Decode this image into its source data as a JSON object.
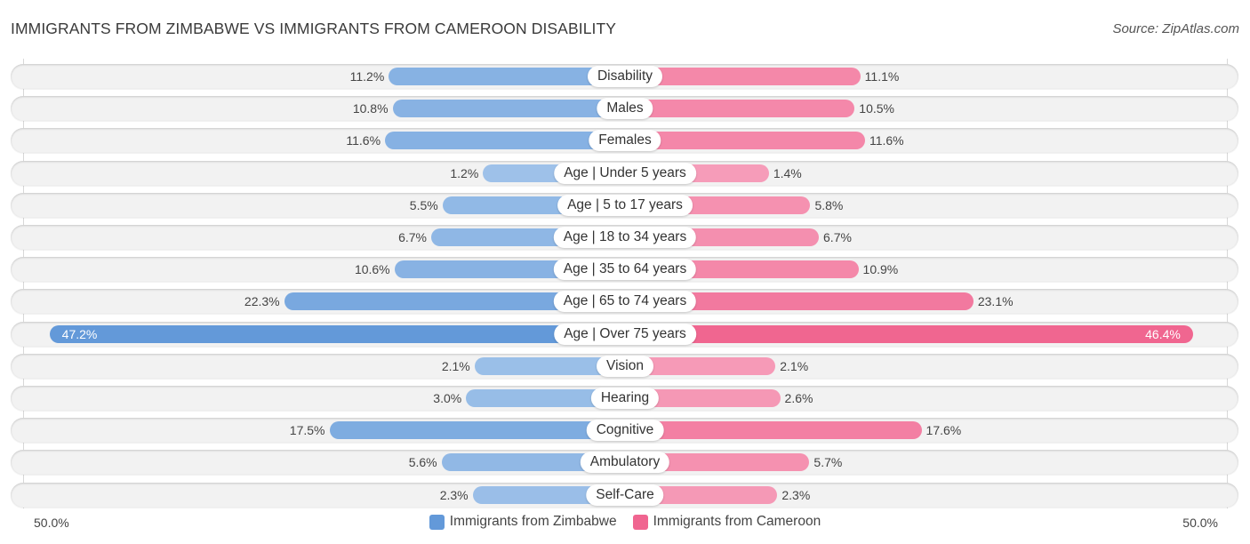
{
  "header": {
    "title": "IMMIGRANTS FROM ZIMBABWE VS IMMIGRANTS FROM CAMEROON DISABILITY",
    "source": "Source: ZipAtlas.com"
  },
  "colors": {
    "zimbabwe_strong": "#6399d9",
    "zimbabwe_light": "#a9c9ec",
    "cameroon_strong": "#f06590",
    "cameroon_light": "#f7a8c1"
  },
  "chart_data": {
    "type": "bar",
    "orientation": "horizontal-diverging",
    "title": "IMMIGRANTS FROM ZIMBABWE VS IMMIGRANTS FROM CAMEROON DISABILITY",
    "xlabel": "",
    "ylabel": "",
    "xlim": [
      0,
      50
    ],
    "axis_ticks": {
      "left": "50.0%",
      "right": "50.0%"
    },
    "legend_position": "bottom-center",
    "categories": [
      "Disability",
      "Males",
      "Females",
      "Age | Under 5 years",
      "Age | 5 to 17 years",
      "Age | 18 to 34 years",
      "Age | 35 to 64 years",
      "Age | 65 to 74 years",
      "Age | Over 75 years",
      "Vision",
      "Hearing",
      "Cognitive",
      "Ambulatory",
      "Self-Care"
    ],
    "series": [
      {
        "name": "Immigrants from Zimbabwe",
        "side": "left",
        "values": [
          11.2,
          10.8,
          11.6,
          1.2,
          5.5,
          6.7,
          10.6,
          22.3,
          47.2,
          2.1,
          3.0,
          17.5,
          5.6,
          2.3
        ],
        "labels": [
          "11.2%",
          "10.8%",
          "11.6%",
          "1.2%",
          "5.5%",
          "6.7%",
          "10.6%",
          "22.3%",
          "47.2%",
          "2.1%",
          "3.0%",
          "17.5%",
          "5.6%",
          "2.3%"
        ]
      },
      {
        "name": "Immigrants from Cameroon",
        "side": "right",
        "values": [
          11.1,
          10.5,
          11.6,
          1.4,
          5.8,
          6.7,
          10.9,
          23.1,
          46.4,
          2.1,
          2.6,
          17.6,
          5.7,
          2.3
        ],
        "labels": [
          "11.1%",
          "10.5%",
          "11.6%",
          "1.4%",
          "5.8%",
          "6.7%",
          "10.9%",
          "23.1%",
          "46.4%",
          "2.1%",
          "2.6%",
          "17.6%",
          "5.7%",
          "2.3%"
        ]
      }
    ]
  },
  "legend": {
    "items": [
      {
        "label": "Immigrants from Zimbabwe",
        "color": "#6399d9"
      },
      {
        "label": "Immigrants from Cameroon",
        "color": "#f06590"
      }
    ]
  }
}
